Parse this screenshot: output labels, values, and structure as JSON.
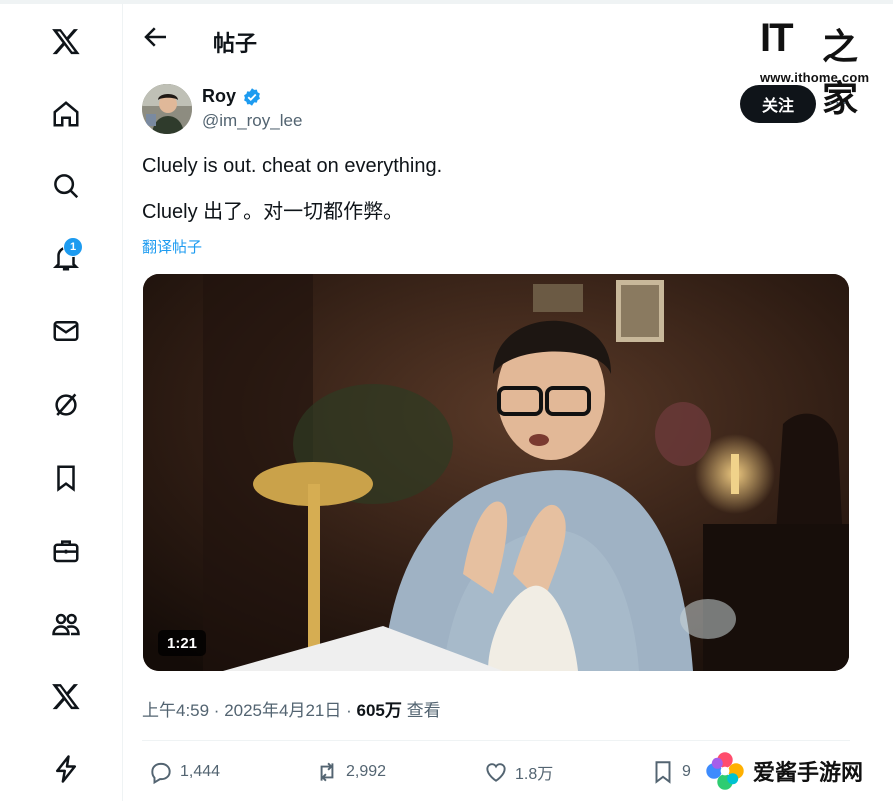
{
  "header": {
    "title": "帖子"
  },
  "sidebar": {
    "notification_count": "1"
  },
  "post": {
    "author_name": "Roy",
    "author_handle": "@im_roy_lee",
    "follow_label": "关注",
    "more_label": "···",
    "text_en": "Cluely is out. cheat on everything.",
    "text_cn": "Cluely 出了。对一切都作弊。",
    "translate_label": "翻译帖子",
    "video_duration": "1:21",
    "time_date": "上午4:59 · 2025年4月21日 · ",
    "views": "605万",
    "views_label": " 查看",
    "replies": "1,444",
    "reposts": "2,992",
    "likes": "1.8万",
    "bookmarks": "9"
  },
  "watermarks": {
    "ithome_logo": "IT",
    "ithome_logo_cn": "之家",
    "ithome_url": "www.ithome.com",
    "site": "爱酱手游网"
  },
  "colors": {
    "accent": "#1d9bf0",
    "text": "#0f1419",
    "muted": "#536471"
  }
}
